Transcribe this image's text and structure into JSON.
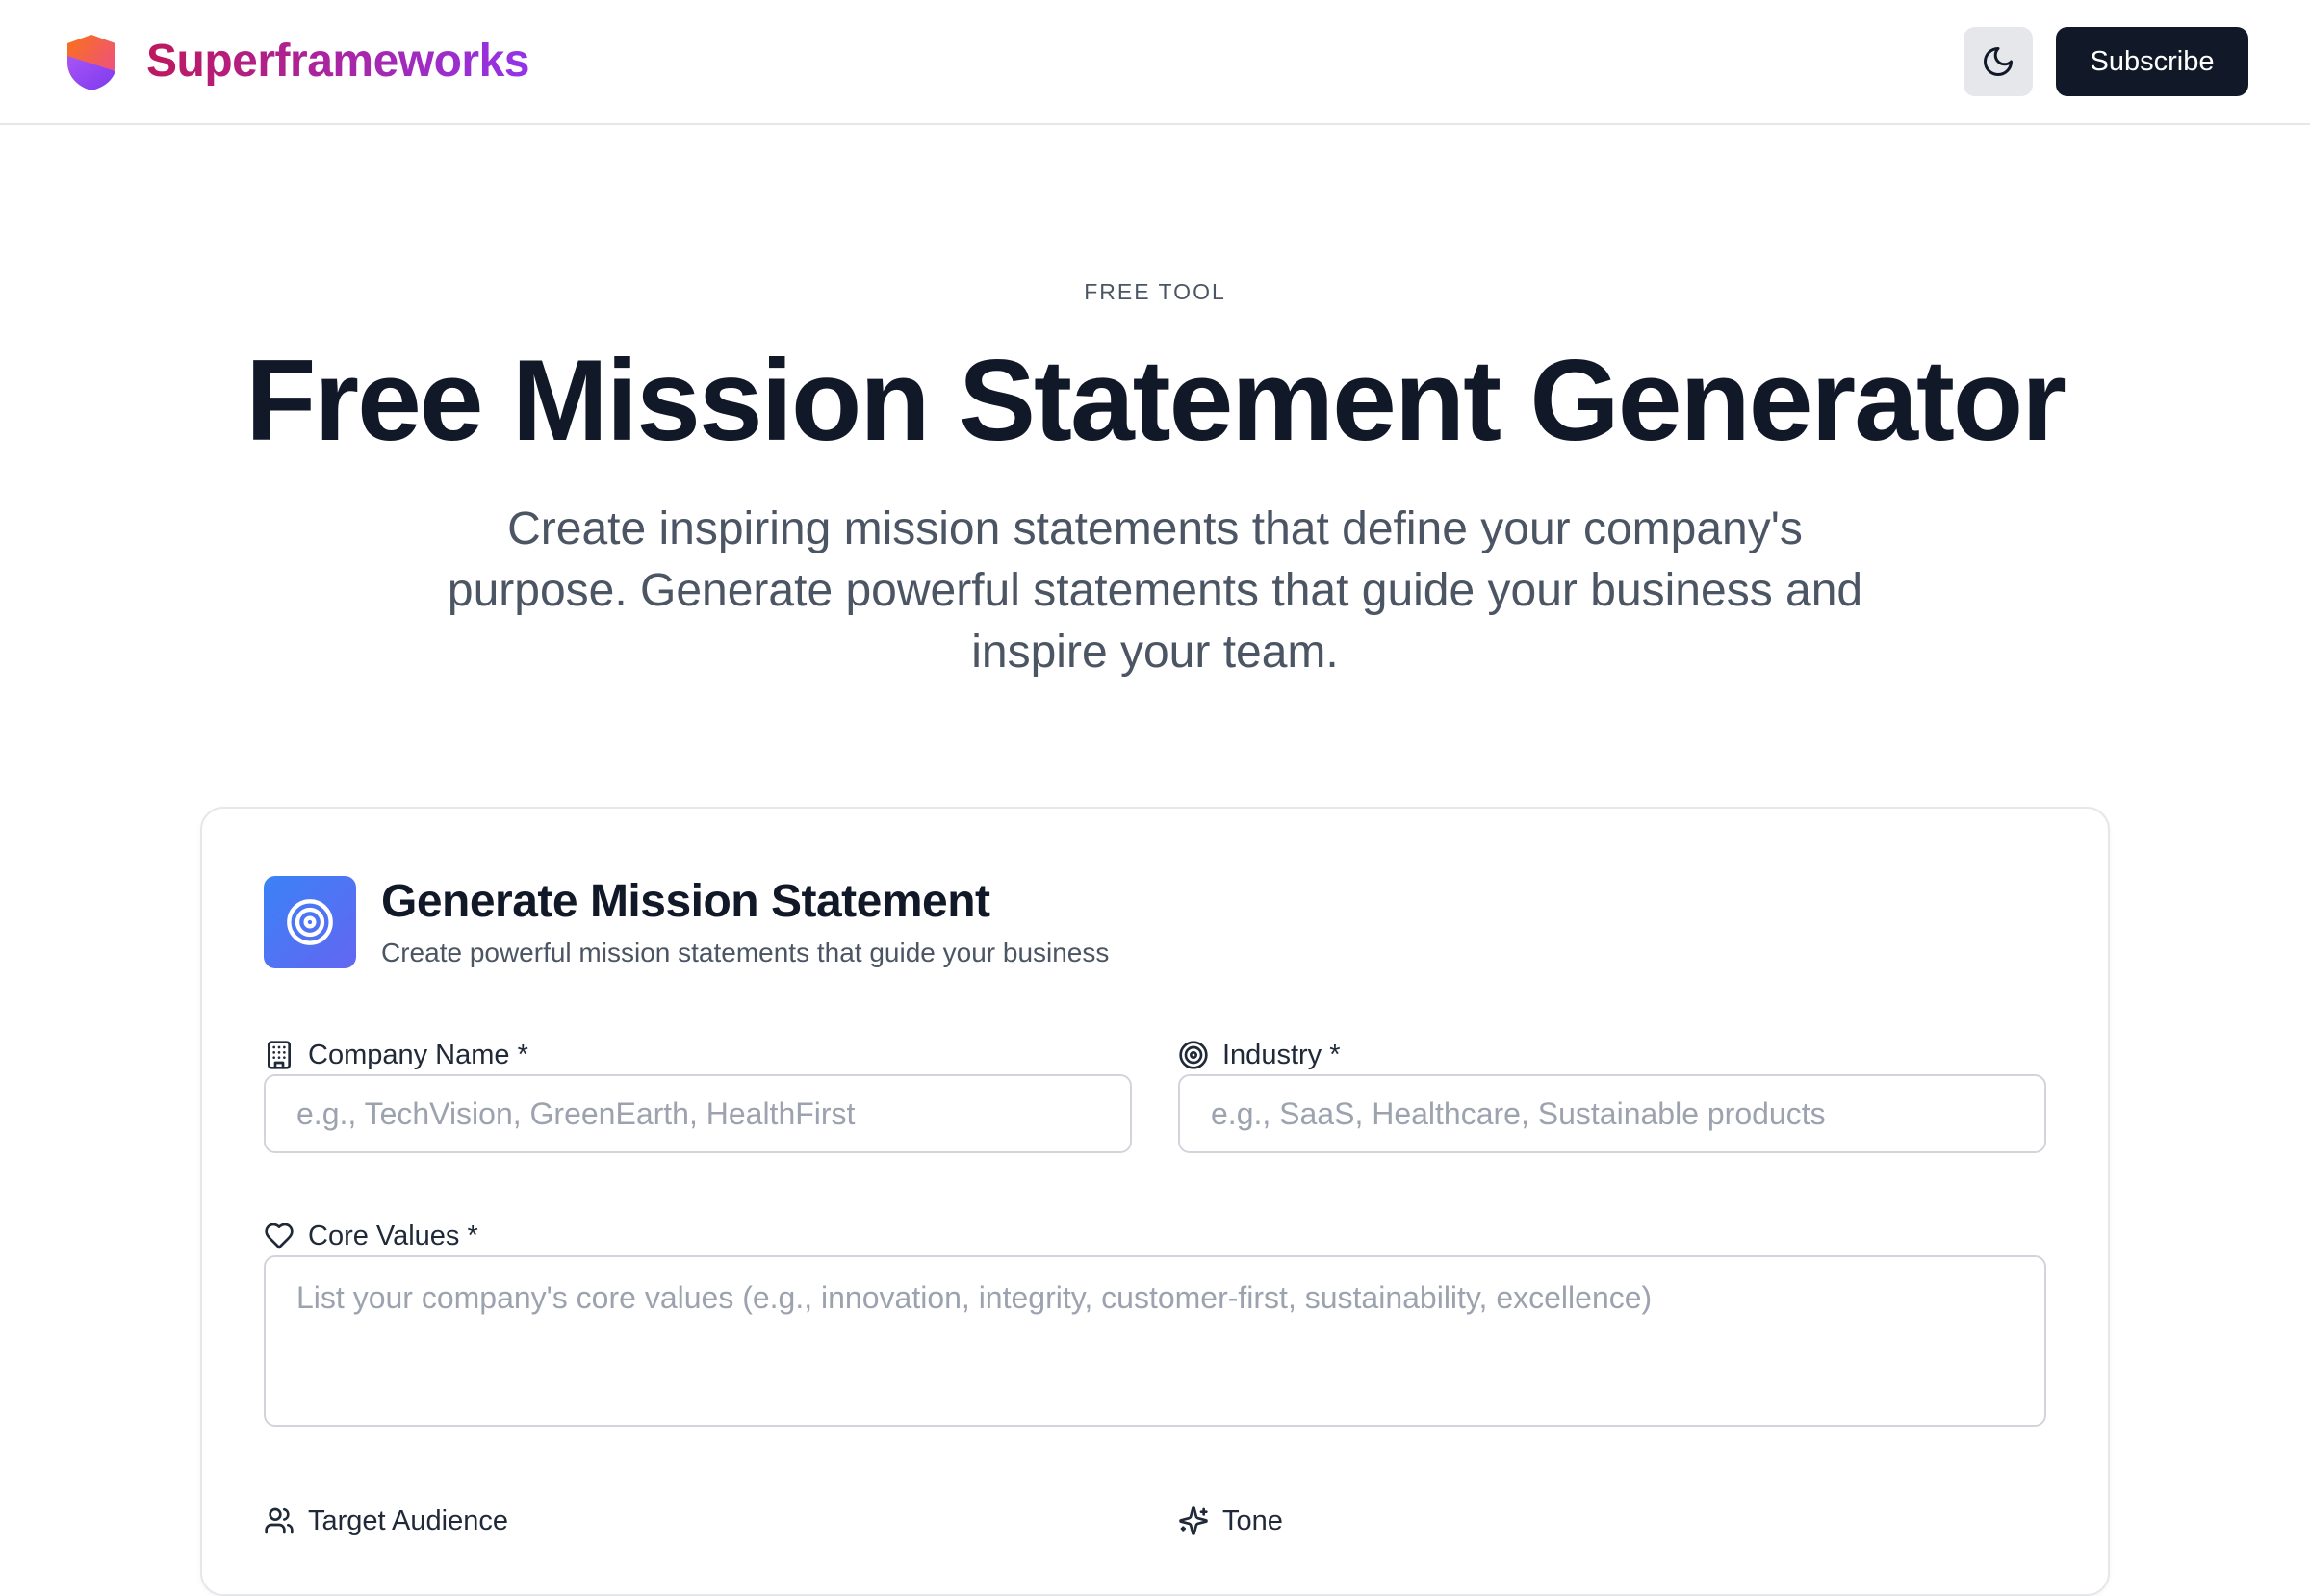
{
  "header": {
    "brand": "Superframeworks",
    "subscribe_label": "Subscribe"
  },
  "hero": {
    "eyebrow": "FREE TOOL",
    "title": "Free Mission Statement Generator",
    "subtitle": "Create inspiring mission statements that define your company's purpose. Generate powerful statements that guide your business and inspire your team."
  },
  "form": {
    "title": "Generate Mission Statement",
    "subtitle": "Create powerful mission statements that guide your business",
    "company_name": {
      "label": "Company Name *",
      "value": "",
      "placeholder": "e.g., TechVision, GreenEarth, HealthFirst"
    },
    "industry": {
      "label": "Industry *",
      "value": "",
      "placeholder": "e.g., SaaS, Healthcare, Sustainable products"
    },
    "core_values": {
      "label": "Core Values *",
      "value": "",
      "placeholder": "List your company's core values (e.g., innovation, integrity, customer-first, sustainability, excellence)"
    },
    "target_audience": {
      "label": "Target Audience"
    },
    "tone": {
      "label": "Tone"
    }
  },
  "colors": {
    "brand_gradient_start": "#be185d",
    "brand_gradient_end": "#9333ea",
    "primary_button": "#111827",
    "card_icon_start": "#3b82f6",
    "card_icon_end": "#6366f1"
  },
  "icons": {
    "logo": "shield-icon",
    "theme_toggle": "moon-icon",
    "card": "target-icon",
    "company_name": "building-icon",
    "industry": "target-icon",
    "core_values": "heart-icon",
    "target_audience": "users-icon",
    "tone": "sparkles-icon"
  }
}
